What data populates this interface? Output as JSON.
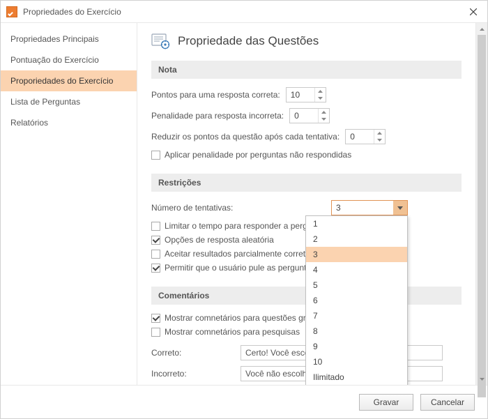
{
  "window": {
    "title": "Propriedades do Exercício"
  },
  "sidebar": {
    "items": [
      {
        "label": "Propriedades Principais"
      },
      {
        "label": "Pontuação do Exercício"
      },
      {
        "label": "Proporiedades do Exercício"
      },
      {
        "label": "Lista de Perguntas"
      },
      {
        "label": "Relatórios"
      }
    ],
    "selected_index": 2
  },
  "page": {
    "title": "Propriedade das Questões",
    "sections": {
      "nota": {
        "heading": "Nota",
        "points_label": "Pontos para uma resposta correta:",
        "points_value": "10",
        "penalty_label": "Penalidade para resposta incorreta:",
        "penalty_value": "0",
        "reduce_label": "Reduzir os pontos da questão após cada tentativa:",
        "reduce_value": "0",
        "apply_penalty_label": "Aplicar penalidade por perguntas não respondidas",
        "apply_penalty_checked": false
      },
      "restricoes": {
        "heading": "Restrições",
        "attempts_label": "Número de tentativas:",
        "attempts_value": "3",
        "attempts_options": [
          "1",
          "2",
          "3",
          "4",
          "5",
          "6",
          "7",
          "8",
          "9",
          "10",
          "Ilimitado"
        ],
        "limit_time_label": "Limitar o tempo para responder a pergunta:",
        "limit_time_checked": false,
        "random_label": "Opções de resposta aleatória",
        "random_checked": true,
        "partial_label": "Aceitar resultados parcialmente corretos",
        "partial_checked": false,
        "skip_label": "Permitir que o usuário pule as perguntas da pesquisa",
        "skip_checked": true
      },
      "comentarios": {
        "heading": "Comentários",
        "show_graded_label": "Mostrar comnetários para questões graduadas",
        "show_graded_checked": true,
        "show_survey_label": "Mostrar comnetários para pesquisas",
        "show_survey_checked": false,
        "correct_label": "Correto:",
        "correct_value": "Certo! Você escolheu a resposta correta.",
        "incorrect_label": "Incorreto:",
        "incorrect_value": "Você não escolheu a resposta correta."
      }
    }
  },
  "footer": {
    "save": "Gravar",
    "cancel": "Cancelar"
  }
}
